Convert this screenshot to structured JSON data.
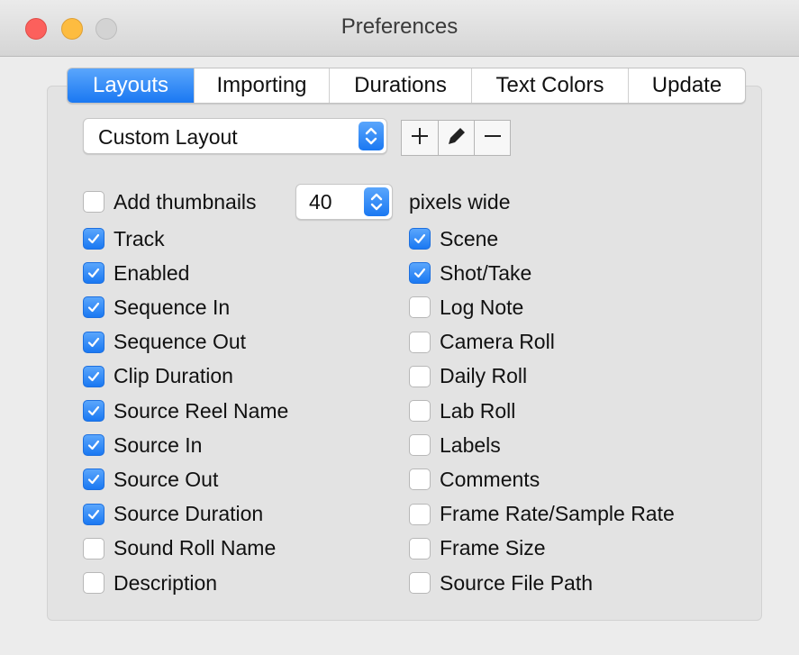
{
  "window": {
    "title": "Preferences"
  },
  "tabs": [
    {
      "label": "Layouts",
      "active": true
    },
    {
      "label": "Importing",
      "active": false
    },
    {
      "label": "Durations",
      "active": false
    },
    {
      "label": "Text Colors",
      "active": false
    },
    {
      "label": "Update",
      "active": false
    }
  ],
  "layout_select": {
    "value": "Custom Layout"
  },
  "toolbar": {
    "add_icon": "plus-icon",
    "edit_icon": "pencil-icon",
    "remove_icon": "minus-icon"
  },
  "thumbnails": {
    "label": "Add thumbnails",
    "checked": false,
    "width_value": "40",
    "suffix": "pixels wide"
  },
  "left_columns": [
    {
      "label": "Track",
      "checked": true
    },
    {
      "label": "Enabled",
      "checked": true
    },
    {
      "label": "Sequence In",
      "checked": true
    },
    {
      "label": "Sequence Out",
      "checked": true
    },
    {
      "label": "Clip Duration",
      "checked": true
    },
    {
      "label": "Source Reel Name",
      "checked": true
    },
    {
      "label": "Source In",
      "checked": true
    },
    {
      "label": "Source Out",
      "checked": true
    },
    {
      "label": "Source Duration",
      "checked": true
    },
    {
      "label": "Sound Roll Name",
      "checked": false
    },
    {
      "label": "Description",
      "checked": false
    }
  ],
  "right_columns": [
    {
      "label": "Scene",
      "checked": true
    },
    {
      "label": "Shot/Take",
      "checked": true
    },
    {
      "label": "Log Note",
      "checked": false
    },
    {
      "label": "Camera Roll",
      "checked": false
    },
    {
      "label": "Daily Roll",
      "checked": false
    },
    {
      "label": "Lab Roll",
      "checked": false
    },
    {
      "label": "Labels",
      "checked": false
    },
    {
      "label": "Comments",
      "checked": false
    },
    {
      "label": "Frame Rate/Sample Rate",
      "checked": false
    },
    {
      "label": "Frame Size",
      "checked": false
    },
    {
      "label": "Source File Path",
      "checked": false
    }
  ],
  "colors": {
    "accent": "#1a78f2",
    "window_bg": "#ececec"
  }
}
